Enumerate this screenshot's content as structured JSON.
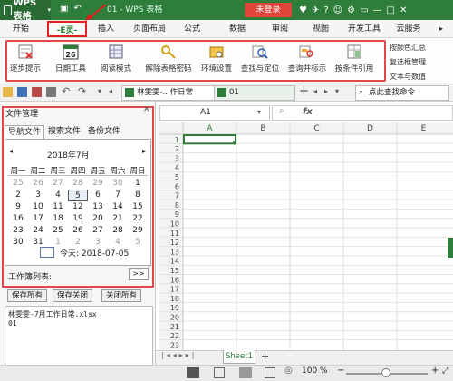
{
  "title_bar": {
    "app_label": "WPS 表格",
    "doc_title": "01 - WPS 表格",
    "login_button": "未登录"
  },
  "menu_tabs": [
    "开始",
    "-E灵-",
    "插入",
    "页面布局",
    "公式",
    "数据",
    "审阅",
    "视图",
    "开发工具",
    "云服务"
  ],
  "ribbon": {
    "buttons": [
      "逐步提示",
      "日期工具",
      "阅读模式",
      "解除表格密码",
      "环境设置",
      "查找与定位",
      "查询并标示",
      "按条件引用"
    ],
    "calendar_icon_text": "26",
    "right_items": [
      "按颜色汇总",
      "复选框管理",
      "文本与数值"
    ]
  },
  "toolbar": {
    "doc_tab1": "林雯雯-...作日常",
    "doc_tab2": "01",
    "search_cmd": "点此查找命令"
  },
  "namebox": "A1",
  "fx_label": "fx",
  "panel": {
    "title": "文件管理",
    "tabs": [
      "导航文件",
      "搜索文件",
      "备份文件"
    ],
    "calendar": {
      "month_title": "2018年7月",
      "weekdays": [
        "周一",
        "周二",
        "周三",
        "周四",
        "周五",
        "周六",
        "周日"
      ],
      "days": [
        [
          "25",
          "26",
          "27",
          "28",
          "29",
          "30",
          "1"
        ],
        [
          "2",
          "3",
          "4",
          "5",
          "6",
          "7",
          "8"
        ],
        [
          "9",
          "10",
          "11",
          "12",
          "13",
          "14",
          "15"
        ],
        [
          "16",
          "17",
          "18",
          "19",
          "20",
          "21",
          "22"
        ],
        [
          "23",
          "24",
          "25",
          "26",
          "27",
          "28",
          "29"
        ],
        [
          "30",
          "31",
          "1",
          "2",
          "3",
          "4",
          "5"
        ]
      ],
      "selected_day": "5",
      "today_label": "今天: 2018-07-05"
    },
    "workbook_label": "工作簿列表:",
    "workbook_btn": ">>",
    "buttons": [
      "保存所有",
      "保存关闭",
      "关闭所有"
    ],
    "files": [
      "林雯雯-7月工作日常.xlsx",
      "01"
    ]
  },
  "grid": {
    "columns": [
      "A",
      "B",
      "C",
      "D",
      "E"
    ],
    "rows": [
      "1",
      "2",
      "3",
      "4",
      "5",
      "6",
      "7",
      "8",
      "9",
      "10",
      "11",
      "12",
      "13",
      "14",
      "15",
      "16",
      "17",
      "18",
      "19",
      "20",
      "21",
      "22",
      "23"
    ]
  },
  "sheet_tab": "Sheet1",
  "zoom": "100 %",
  "colors": {
    "brand_green": "#2f7d3a",
    "highlight_red": "#e24848",
    "login_red": "#e0453a"
  }
}
